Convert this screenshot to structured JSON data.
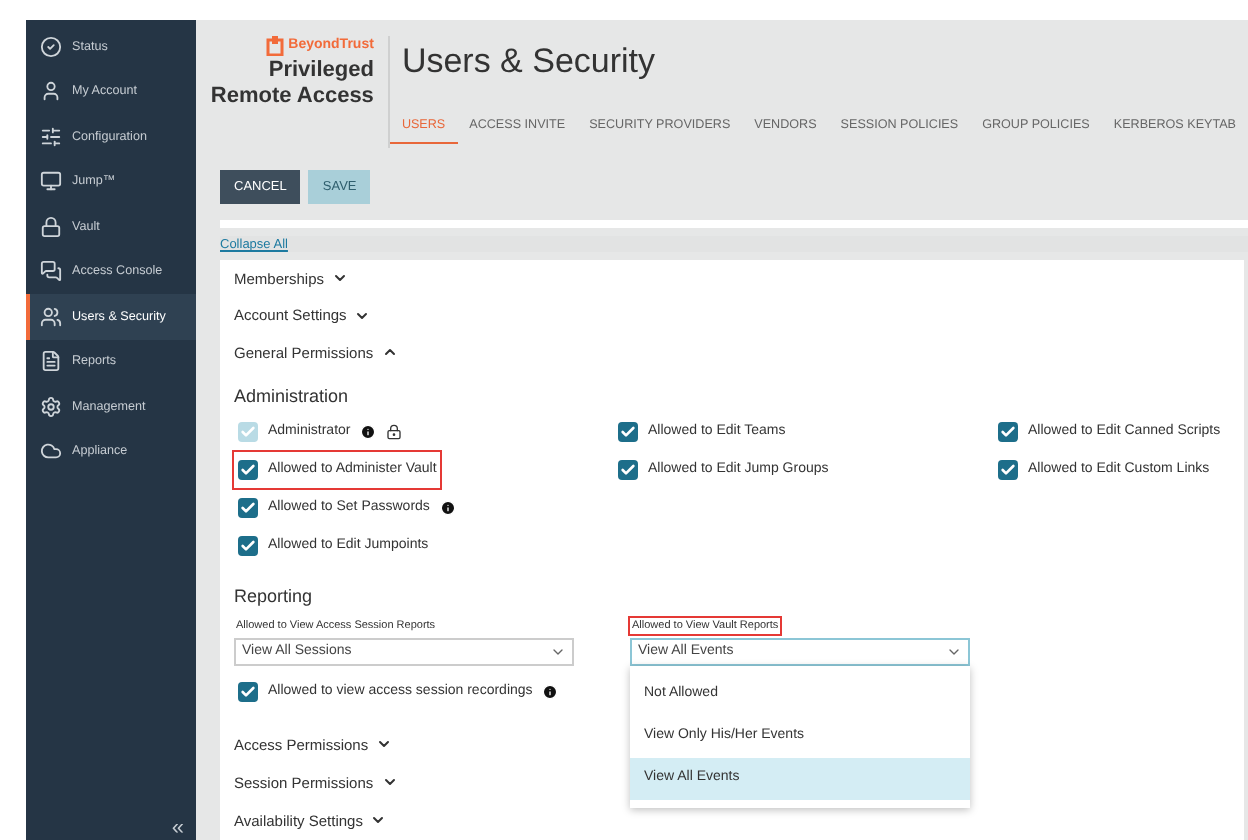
{
  "sidebar": {
    "items": [
      {
        "label": "Status",
        "selected": false
      },
      {
        "label": "My Account",
        "selected": false
      },
      {
        "label": "Configuration",
        "selected": false
      },
      {
        "label": "Jump™",
        "selected": false
      },
      {
        "label": "Vault",
        "selected": false
      },
      {
        "label": "Access Console",
        "selected": false
      },
      {
        "label": "Users & Security",
        "selected": true
      },
      {
        "label": "Reports",
        "selected": false
      },
      {
        "label": "Management",
        "selected": false
      },
      {
        "label": "Appliance",
        "selected": false
      }
    ],
    "collapse": "«"
  },
  "logo": {
    "brand": "BeyondTrust",
    "product_line1": "Privileged",
    "product_line2": "Remote Access"
  },
  "page_title": "Users & Security",
  "tabs": [
    {
      "label": "USERS",
      "selected": true
    },
    {
      "label": "ACCESS INVITE",
      "selected": false
    },
    {
      "label": "SECURITY PROVIDERS",
      "selected": false
    },
    {
      "label": "VENDORS",
      "selected": false
    },
    {
      "label": "SESSION POLICIES",
      "selected": false
    },
    {
      "label": "GROUP POLICIES",
      "selected": false
    },
    {
      "label": "KERBEROS KEYTAB",
      "selected": false
    }
  ],
  "buttons": [
    {
      "label": "CANCEL",
      "disabled": false
    },
    {
      "label": "SAVE",
      "disabled": true
    }
  ],
  "collapse_all": "Collapse All",
  "sections_top": [
    {
      "label": "Memberships",
      "expanded": false
    },
    {
      "label": "Account Settings",
      "expanded": false
    },
    {
      "label": "General Permissions",
      "expanded": true
    }
  ],
  "administration": {
    "title": "Administration",
    "columns": [
      [
        {
          "label": "Administrator",
          "checked": true,
          "disabled": true,
          "info": true,
          "lock": true,
          "highlighted": false
        },
        {
          "label": "Allowed to Administer Vault",
          "checked": true,
          "disabled": false,
          "info": false,
          "lock": false,
          "highlighted": true
        },
        {
          "label": "Allowed to Set Passwords",
          "checked": true,
          "disabled": false,
          "info": true,
          "lock": false,
          "highlighted": false
        },
        {
          "label": "Allowed to Edit Jumpoints",
          "checked": true,
          "disabled": false,
          "info": false,
          "lock": false,
          "highlighted": false
        }
      ],
      [
        {
          "label": "Allowed to Edit Teams",
          "checked": true,
          "disabled": false,
          "info": false,
          "lock": false,
          "highlighted": false
        },
        {
          "label": "Allowed to Edit Jump Groups",
          "checked": true,
          "disabled": false,
          "info": false,
          "lock": false,
          "highlighted": false
        }
      ],
      [
        {
          "label": "Allowed to Edit Canned Scripts",
          "checked": true,
          "disabled": false,
          "info": false,
          "lock": false,
          "highlighted": false
        },
        {
          "label": "Allowed to Edit Custom Links",
          "checked": true,
          "disabled": false,
          "info": false,
          "lock": false,
          "highlighted": false
        }
      ]
    ]
  },
  "reporting": {
    "title": "Reporting",
    "session_reports": {
      "label": "Allowed to View Access Session Reports",
      "value": "View All Sessions",
      "highlighted": false
    },
    "vault_reports": {
      "label": "Allowed to View Vault Reports",
      "value": "View All Events",
      "highlighted": true,
      "expanded": true,
      "options": [
        {
          "label": "Not Allowed",
          "selected": false
        },
        {
          "label": "View Only His/Her Events",
          "selected": false
        },
        {
          "label": "View All Events",
          "selected": true
        }
      ]
    },
    "recordings": {
      "label": "Allowed to view access session recordings",
      "checked": true,
      "info": true
    }
  },
  "sections_bottom": [
    {
      "label": "Access Permissions",
      "expanded": false
    },
    {
      "label": "Session Permissions",
      "expanded": false
    },
    {
      "label": "Availability Settings",
      "expanded": false
    }
  ]
}
